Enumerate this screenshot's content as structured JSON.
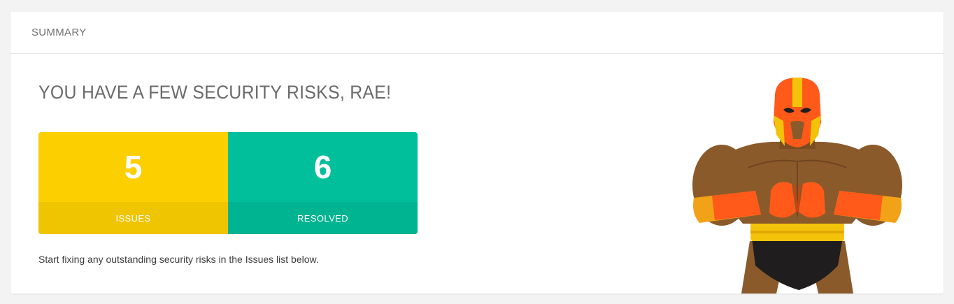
{
  "card": {
    "title": "SUMMARY"
  },
  "headline": "YOU HAVE A FEW SECURITY RISKS, RAE!",
  "stats": [
    {
      "value": "5",
      "label": "ISSUES",
      "color": "#fccf00"
    },
    {
      "value": "6",
      "label": "RESOLVED",
      "color": "#00bf9a"
    }
  ],
  "description": "Start fixing any outstanding security risks in the Issues list below.",
  "illustration": {
    "name": "wrestler-mascot-illustration"
  }
}
